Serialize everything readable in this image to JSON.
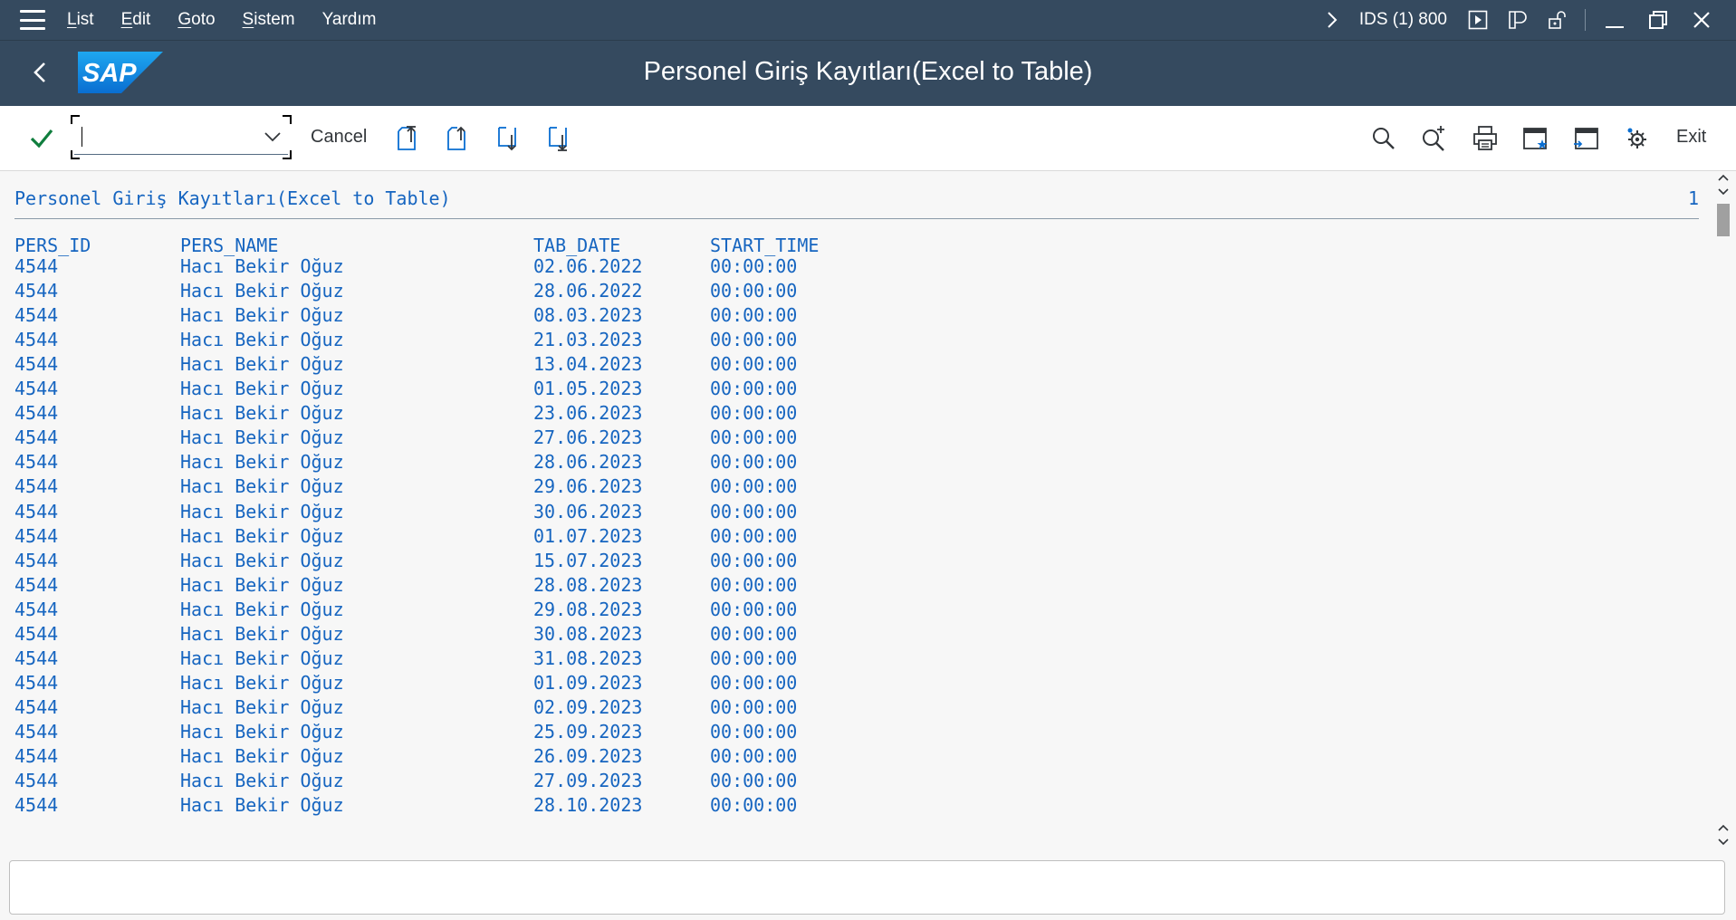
{
  "menubar": {
    "items": [
      {
        "key": "L",
        "rest": "ist"
      },
      {
        "key": "E",
        "rest": "dit"
      },
      {
        "key": "G",
        "rest": "oto"
      },
      {
        "key": "S",
        "rest": "istem"
      },
      {
        "key": "",
        "rest": "Yardım"
      }
    ],
    "system_info": "IDS (1) 800"
  },
  "titlebar": {
    "logo_text": "SAP",
    "title": "Personel Giriş Kayıtları(Excel to Table)"
  },
  "toolbar": {
    "command_value": "",
    "cancel_label": "Cancel",
    "exit_label": "Exit"
  },
  "list": {
    "title": "Personel Giriş Kayıtları(Excel to Table)",
    "page": "1",
    "headers": {
      "pers_id": "PERS_ID",
      "pers_name": "PERS_NAME",
      "tab_date": "TAB_DATE",
      "start_time": "START_TIME"
    },
    "rows": [
      {
        "pers_id": "4544",
        "pers_name": "Hacı Bekir Oğuz",
        "tab_date": "02.06.2022",
        "start_time": "00:00:00"
      },
      {
        "pers_id": "4544",
        "pers_name": "Hacı Bekir Oğuz",
        "tab_date": "28.06.2022",
        "start_time": "00:00:00"
      },
      {
        "pers_id": "4544",
        "pers_name": "Hacı Bekir Oğuz",
        "tab_date": "08.03.2023",
        "start_time": "00:00:00"
      },
      {
        "pers_id": "4544",
        "pers_name": "Hacı Bekir Oğuz",
        "tab_date": "21.03.2023",
        "start_time": "00:00:00"
      },
      {
        "pers_id": "4544",
        "pers_name": "Hacı Bekir Oğuz",
        "tab_date": "13.04.2023",
        "start_time": "00:00:00"
      },
      {
        "pers_id": "4544",
        "pers_name": "Hacı Bekir Oğuz",
        "tab_date": "01.05.2023",
        "start_time": "00:00:00"
      },
      {
        "pers_id": "4544",
        "pers_name": "Hacı Bekir Oğuz",
        "tab_date": "23.06.2023",
        "start_time": "00:00:00"
      },
      {
        "pers_id": "4544",
        "pers_name": "Hacı Bekir Oğuz",
        "tab_date": "27.06.2023",
        "start_time": "00:00:00"
      },
      {
        "pers_id": "4544",
        "pers_name": "Hacı Bekir Oğuz",
        "tab_date": "28.06.2023",
        "start_time": "00:00:00"
      },
      {
        "pers_id": "4544",
        "pers_name": "Hacı Bekir Oğuz",
        "tab_date": "29.06.2023",
        "start_time": "00:00:00"
      },
      {
        "pers_id": "4544",
        "pers_name": "Hacı Bekir Oğuz",
        "tab_date": "30.06.2023",
        "start_time": "00:00:00"
      },
      {
        "pers_id": "4544",
        "pers_name": "Hacı Bekir Oğuz",
        "tab_date": "01.07.2023",
        "start_time": "00:00:00"
      },
      {
        "pers_id": "4544",
        "pers_name": "Hacı Bekir Oğuz",
        "tab_date": "15.07.2023",
        "start_time": "00:00:00"
      },
      {
        "pers_id": "4544",
        "pers_name": "Hacı Bekir Oğuz",
        "tab_date": "28.08.2023",
        "start_time": "00:00:00"
      },
      {
        "pers_id": "4544",
        "pers_name": "Hacı Bekir Oğuz",
        "tab_date": "29.08.2023",
        "start_time": "00:00:00"
      },
      {
        "pers_id": "4544",
        "pers_name": "Hacı Bekir Oğuz",
        "tab_date": "30.08.2023",
        "start_time": "00:00:00"
      },
      {
        "pers_id": "4544",
        "pers_name": "Hacı Bekir Oğuz",
        "tab_date": "31.08.2023",
        "start_time": "00:00:00"
      },
      {
        "pers_id": "4544",
        "pers_name": "Hacı Bekir Oğuz",
        "tab_date": "01.09.2023",
        "start_time": "00:00:00"
      },
      {
        "pers_id": "4544",
        "pers_name": "Hacı Bekir Oğuz",
        "tab_date": "02.09.2023",
        "start_time": "00:00:00"
      },
      {
        "pers_id": "4544",
        "pers_name": "Hacı Bekir Oğuz",
        "tab_date": "25.09.2023",
        "start_time": "00:00:00"
      },
      {
        "pers_id": "4544",
        "pers_name": "Hacı Bekir Oğuz",
        "tab_date": "26.09.2023",
        "start_time": "00:00:00"
      },
      {
        "pers_id": "4544",
        "pers_name": "Hacı Bekir Oğuz",
        "tab_date": "27.09.2023",
        "start_time": "00:00:00"
      },
      {
        "pers_id": "4544",
        "pers_name": "Hacı Bekir Oğuz",
        "tab_date": "28.10.2023",
        "start_time": "00:00:00"
      }
    ]
  },
  "statusbar": {
    "message": ""
  },
  "icons": {
    "menu": "hamburger-icon",
    "nav_forward": "chevron-right-icon",
    "play": "play-icon",
    "layout": "layout-icon",
    "unlock": "unlock-icon",
    "minimize": "minimize-icon",
    "restore": "restore-icon",
    "close": "close-icon",
    "back": "back-icon",
    "enter": "check-icon",
    "first_page": "first-page-icon",
    "prev_page": "previous-page-icon",
    "next_page": "next-page-icon",
    "last_page": "last-page-icon",
    "find": "search-icon",
    "find_next": "find-next-icon",
    "print": "print-icon",
    "new_session": "new-session-icon",
    "shortcut": "shortcut-icon",
    "settings": "settings-icon"
  },
  "colors": {
    "header_bg": "#354a5f",
    "list_text": "#1665c0",
    "check": "#107e3e",
    "page_bg": "#f7f7f7"
  }
}
